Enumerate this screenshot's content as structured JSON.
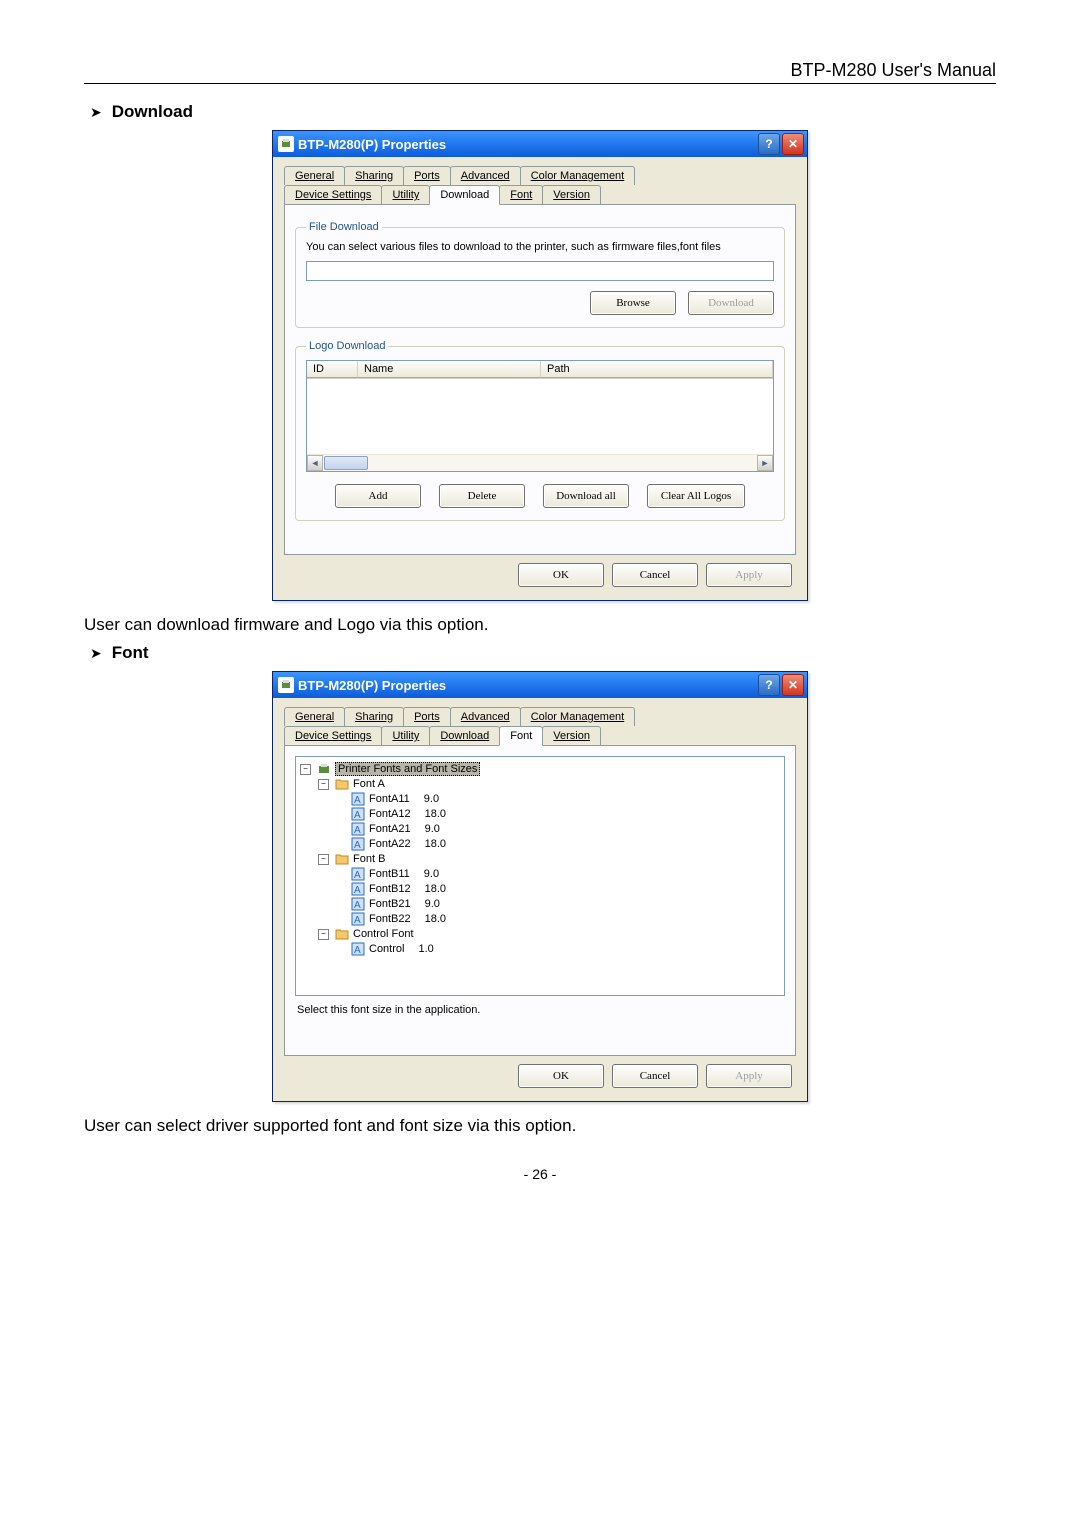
{
  "header": {
    "title": "BTP-M280 User's Manual"
  },
  "section1": {
    "bullet": "Download",
    "dialog_title": "BTP-M280(P) Properties",
    "tabs_row1": [
      "General",
      "Sharing",
      "Ports",
      "Advanced",
      "Color Management"
    ],
    "tabs_row2": [
      "Device Settings",
      "Utility",
      "Download",
      "Font",
      "Version"
    ],
    "active_tab": "Download",
    "file_download": {
      "legend": "File Download",
      "desc": "You can select various files to download to the printer, such as firmware files,font files",
      "input_value": "",
      "browse": "Browse",
      "download": "Download"
    },
    "logo_download": {
      "legend": "Logo Download",
      "cols": {
        "id": "ID",
        "name": "Name",
        "path": "Path"
      },
      "add": "Add",
      "delete": "Delete",
      "download_all": "Download all",
      "clear_all": "Clear All Logos"
    },
    "footer": {
      "ok": "OK",
      "cancel": "Cancel",
      "apply": "Apply"
    },
    "post_text": "User can download firmware and Logo via this option."
  },
  "section2": {
    "bullet": "Font",
    "dialog_title": "BTP-M280(P) Properties",
    "tabs_row1": [
      "General",
      "Sharing",
      "Ports",
      "Advanced",
      "Color Management"
    ],
    "tabs_row2": [
      "Device Settings",
      "Utility",
      "Download",
      "Font",
      "Version"
    ],
    "active_tab": "Font",
    "tree": {
      "root": "Printer Fonts and Font Sizes",
      "font_a": {
        "label": "Font A",
        "items": [
          {
            "name": "FontA11",
            "size": "9.0"
          },
          {
            "name": "FontA12",
            "size": "18.0"
          },
          {
            "name": "FontA21",
            "size": "9.0"
          },
          {
            "name": "FontA22",
            "size": "18.0"
          }
        ]
      },
      "font_b": {
        "label": "Font B",
        "items": [
          {
            "name": "FontB11",
            "size": "9.0"
          },
          {
            "name": "FontB12",
            "size": "18.0"
          },
          {
            "name": "FontB21",
            "size": "9.0"
          },
          {
            "name": "FontB22",
            "size": "18.0"
          }
        ]
      },
      "control": {
        "label": "Control Font",
        "items": [
          {
            "name": "Control",
            "size": "1.0"
          }
        ]
      }
    },
    "desc": "Select this font size in the application.",
    "footer": {
      "ok": "OK",
      "cancel": "Cancel",
      "apply": "Apply"
    },
    "post_text": "User can select driver supported font and font size via this option."
  },
  "page_number": "- 26 -"
}
